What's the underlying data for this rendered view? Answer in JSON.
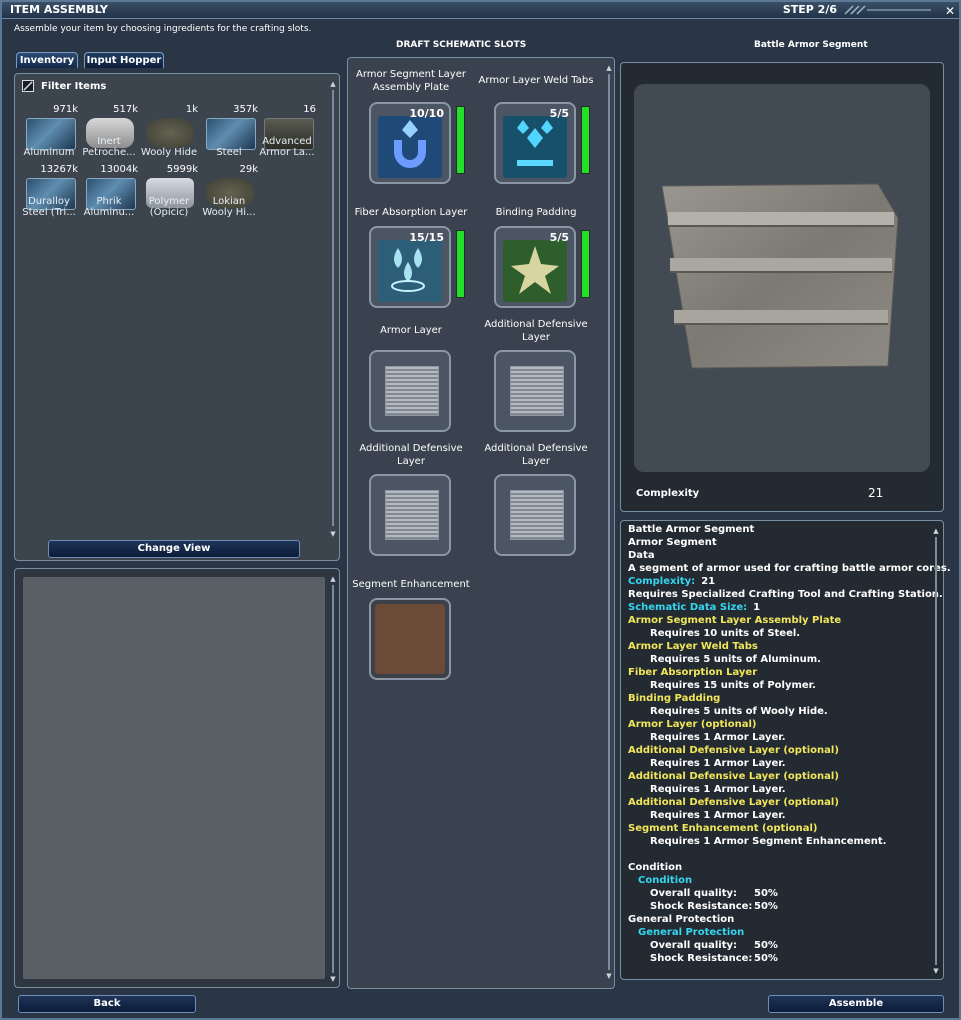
{
  "window": {
    "title": "ITEM ASSEMBLY",
    "step": "STEP 2/6",
    "subtitle": "Assemble your item by choosing ingredients for the crafting slots."
  },
  "tabs": [
    {
      "label": "Inventory",
      "active": true
    },
    {
      "label": "Input Hopper",
      "active": false
    }
  ],
  "filter": {
    "label": "Filter Items"
  },
  "inventory": [
    {
      "count": "971k",
      "name": "Aluminum",
      "icon": "metal-crate-icon"
    },
    {
      "count": "517k",
      "name": "Inert Petroche...",
      "icon": "petrochem-barrel-icon"
    },
    {
      "count": "1k",
      "name": "Wooly Hide",
      "icon": "hide-icon"
    },
    {
      "count": "357k",
      "name": "Steel",
      "icon": "metal-crate-icon"
    },
    {
      "count": "16",
      "name": "Advanced Armor La...",
      "icon": "armor-layer-box-icon"
    },
    {
      "count": "13267k",
      "name": "Duralloy Steel (Tri...",
      "icon": "metal-crate-icon"
    },
    {
      "count": "13004k",
      "name": "Phrik Aluminu...",
      "icon": "metal-crate-icon"
    },
    {
      "count": "5999k",
      "name": "Polymer (Opicic)",
      "icon": "polymer-icon"
    },
    {
      "count": "29k",
      "name": "Lokian Wooly Hi...",
      "icon": "hide-icon"
    }
  ],
  "buttons": {
    "change_view": "Change View",
    "back": "Back",
    "assemble": "Assemble"
  },
  "schematic": {
    "header": "DRAFT SCHEMATIC SLOTS",
    "slots": [
      {
        "label": "Armor Segment Layer Assembly Plate",
        "count": "10/10",
        "fill": 1.0,
        "icon": "magnet-icon"
      },
      {
        "label": "Armor Layer Weld Tabs",
        "count": "5/5",
        "fill": 1.0,
        "icon": "weld-tabs-icon"
      },
      {
        "label": "Fiber Absorption Layer",
        "count": "15/15",
        "fill": 1.0,
        "icon": "droplets-icon"
      },
      {
        "label": "Binding Padding",
        "count": "5/5",
        "fill": 1.0,
        "icon": "padding-star-icon"
      },
      {
        "label": "Armor Layer",
        "count": "",
        "fill": 0,
        "icon": "empty-slot-icon"
      },
      {
        "label": "Additional Defensive Layer",
        "count": "",
        "fill": 0,
        "icon": "empty-slot-icon"
      },
      {
        "label": "Additional Defensive Layer",
        "count": "",
        "fill": 0,
        "icon": "empty-slot-icon"
      },
      {
        "label": "Additional Defensive Layer",
        "count": "",
        "fill": 0,
        "icon": "empty-slot-icon"
      },
      {
        "label": "Segment Enhancement",
        "count": "",
        "fill": 0,
        "icon": "enhancement-slot-icon"
      }
    ]
  },
  "preview": {
    "title": "Battle Armor Segment",
    "complexity_label": "Complexity",
    "complexity_value": "21"
  },
  "info": [
    {
      "text": "Battle Armor Segment",
      "style": "white bold"
    },
    {
      "text": "Armor Segment",
      "style": "white"
    },
    {
      "text": "Data",
      "style": "white"
    },
    {
      "text": "A segment of armor used for crafting battle armor cores.",
      "style": "white"
    },
    {
      "label": "Complexity:",
      "value": "21",
      "style": "cyan-pair"
    },
    {
      "text": "Requires Specialized Crafting Tool and Crafting Station.",
      "style": "white"
    },
    {
      "label": "Schematic Data Size:",
      "value": "1",
      "style": "cyan-pair"
    },
    {
      "text": "Armor Segment Layer Assembly Plate",
      "style": "yellow"
    },
    {
      "text": "Requires 10 units of Steel.",
      "style": "indent"
    },
    {
      "text": "Armor Layer Weld Tabs",
      "style": "yellow"
    },
    {
      "text": "Requires 5 units of Aluminum.",
      "style": "indent"
    },
    {
      "text": "Fiber Absorption Layer",
      "style": "yellow"
    },
    {
      "text": "Requires 15 units of Polymer.",
      "style": "indent"
    },
    {
      "text": "Binding Padding",
      "style": "yellow"
    },
    {
      "text": "Requires 5 units of Wooly Hide.",
      "style": "indent"
    },
    {
      "text": "Armor Layer (optional)",
      "style": "yellow"
    },
    {
      "text": "Requires 1 Armor Layer.",
      "style": "indent"
    },
    {
      "text": "Additional Defensive Layer (optional)",
      "style": "yellow"
    },
    {
      "text": "Requires 1 Armor Layer.",
      "style": "indent"
    },
    {
      "text": "Additional Defensive Layer (optional)",
      "style": "yellow"
    },
    {
      "text": "Requires 1 Armor Layer.",
      "style": "indent"
    },
    {
      "text": "Additional Defensive Layer (optional)",
      "style": "yellow"
    },
    {
      "text": "Requires 1 Armor Layer.",
      "style": "indent"
    },
    {
      "text": "Segment Enhancement (optional)",
      "style": "yellow"
    },
    {
      "text": "Requires 1 Armor Segment Enhancement.",
      "style": "indent"
    },
    {
      "text": "",
      "style": "blank"
    },
    {
      "text": "Condition",
      "style": "white"
    },
    {
      "text": "Condition",
      "style": "cyan-sub"
    },
    {
      "label": "Overall quality:",
      "value": "50%",
      "style": "stat"
    },
    {
      "label": "Shock Resistance:",
      "value": "50%",
      "style": "stat"
    },
    {
      "text": "General Protection",
      "style": "white"
    },
    {
      "text": "General Protection",
      "style": "cyan-sub"
    },
    {
      "label": "Overall quality:",
      "value": "50%",
      "style": "stat"
    },
    {
      "label": "Shock Resistance:",
      "value": "50%",
      "style": "stat"
    }
  ]
}
